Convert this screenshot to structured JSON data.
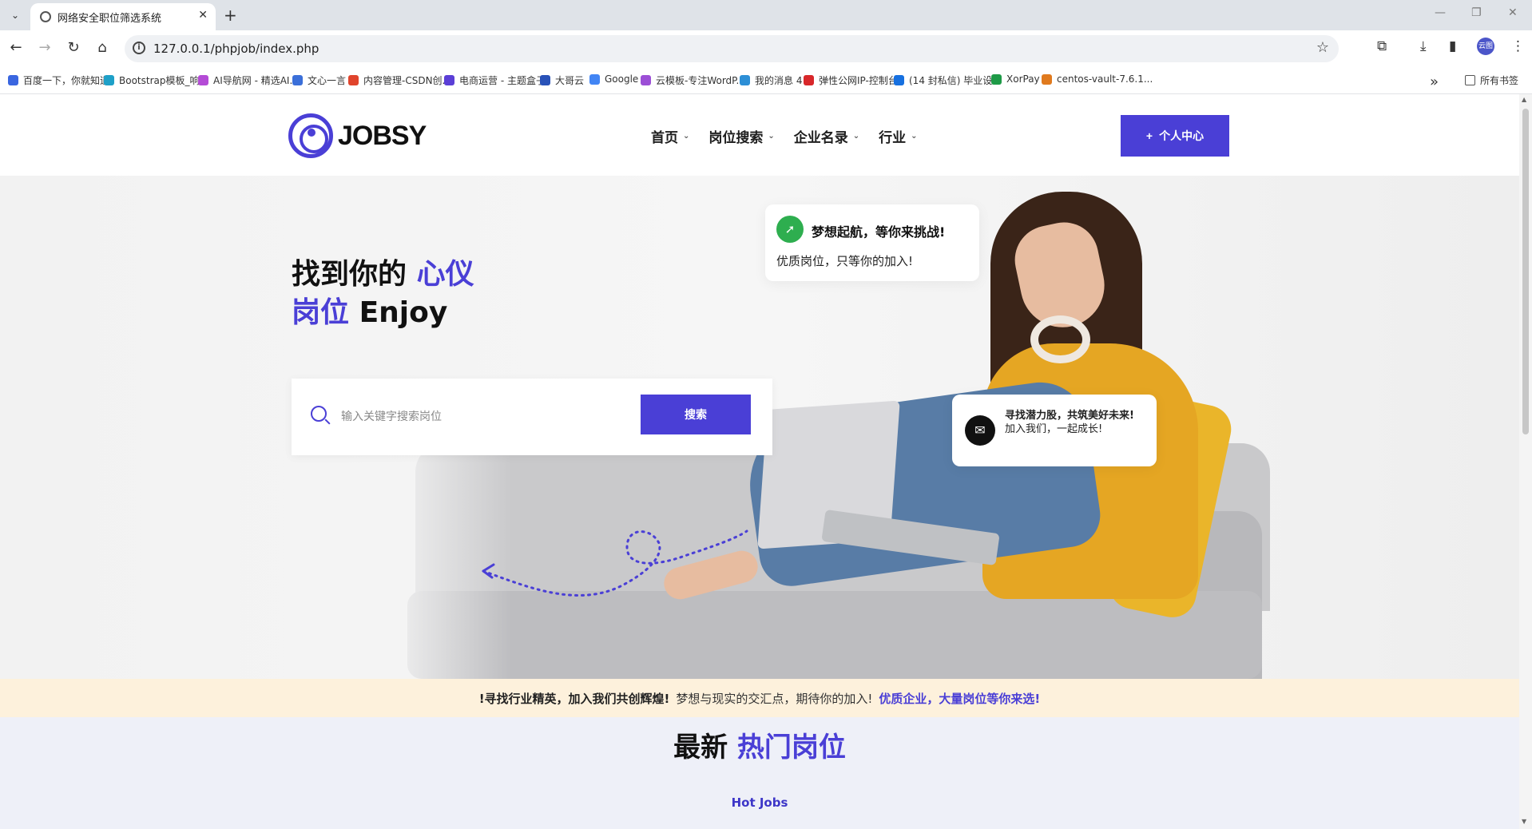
{
  "browser": {
    "tab_title": "网络安全职位筛选系统",
    "url": "127.0.0.1/phpjob/index.php",
    "profile_label": "云图"
  },
  "bookmarks": [
    {
      "label": "百度一下，你就知道",
      "color": "#3a66e0"
    },
    {
      "label": "Bootstrap模板_响...",
      "color": "#1ea0c8"
    },
    {
      "label": "AI导航网 - 精选AI...",
      "color": "#b44bd6"
    },
    {
      "label": "文心一言",
      "color": "#3b6fd9"
    },
    {
      "label": "内容管理-CSDN创...",
      "color": "#e0442c"
    },
    {
      "label": "电商运营 - 主题盒子",
      "color": "#5b3fd6"
    },
    {
      "label": "大哥云",
      "color": "#2952b8"
    },
    {
      "label": "Google",
      "color": "#4285f4"
    },
    {
      "label": "云模板-专注WordP...",
      "color": "#9c4fd6"
    },
    {
      "label": "我的消息 4",
      "color": "#2d8fd6"
    },
    {
      "label": "弹性公网IP-控制台",
      "color": "#d8272a"
    },
    {
      "label": "(14 封私信) 毕业设...",
      "color": "#1670e0"
    },
    {
      "label": "XorPay",
      "color": "#1e9a47"
    },
    {
      "label": "centos-vault-7.6.1...",
      "color": "#e07a1e"
    }
  ],
  "bookmarks_folder": "所有书签",
  "site": {
    "logo_text": "JOBSY",
    "nav": [
      {
        "label": "首页"
      },
      {
        "label": "岗位搜索"
      },
      {
        "label": "企业名录"
      },
      {
        "label": "行业"
      }
    ],
    "cta_label": "个人中心"
  },
  "hero": {
    "title_part1": "找到你的",
    "title_hl1": "心仪",
    "title_hl2": "岗位",
    "title_part2": "Enjoy",
    "search_placeholder": "输入关键字搜索岗位",
    "search_button": "搜索",
    "bubble1_title": "梦想起航，等你来挑战!",
    "bubble1_sub": "优质岗位，只等你的加入!",
    "bubble2_strong": "寻找潜力股，共筑美好未来!",
    "bubble2_text": "加入我们，一起成长!"
  },
  "marquee": {
    "part1": "!寻找行业精英，加入我们共创辉煌!",
    "part2": "梦想与现实的交汇点，期待你的加入!",
    "part3": "优质企业，大量岗位等你来选!"
  },
  "section": {
    "title_plain": "最新",
    "title_hl": "热门岗位",
    "subtitle": "Hot Jobs"
  },
  "colors": {
    "accent": "#4a3fd6",
    "marquee_bg": "#fdf1dc"
  }
}
